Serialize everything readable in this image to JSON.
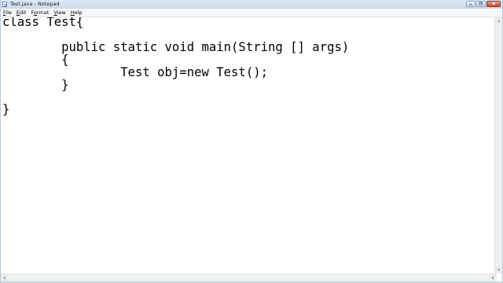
{
  "window": {
    "title": "Test.java - Notepad"
  },
  "menubar": {
    "items": [
      {
        "mnemonic": "F",
        "rest": "ile"
      },
      {
        "mnemonic": "E",
        "rest": "dit"
      },
      {
        "mnemonic": "",
        "pre": "F",
        "mnem_mid": "o",
        "rest": "rmat"
      },
      {
        "mnemonic": "V",
        "rest": "iew"
      },
      {
        "mnemonic": "H",
        "rest": "elp"
      }
    ]
  },
  "editor": {
    "content": "class Test{\n\n\tpublic static void main(String [] args)\n\t{\n\t\tTest obj=new Test();\n\t}\n\n}"
  },
  "icons": {
    "app": "notepad-icon",
    "minimize": "minimize-icon",
    "maximize": "maximize-icon",
    "close": "close-icon"
  }
}
